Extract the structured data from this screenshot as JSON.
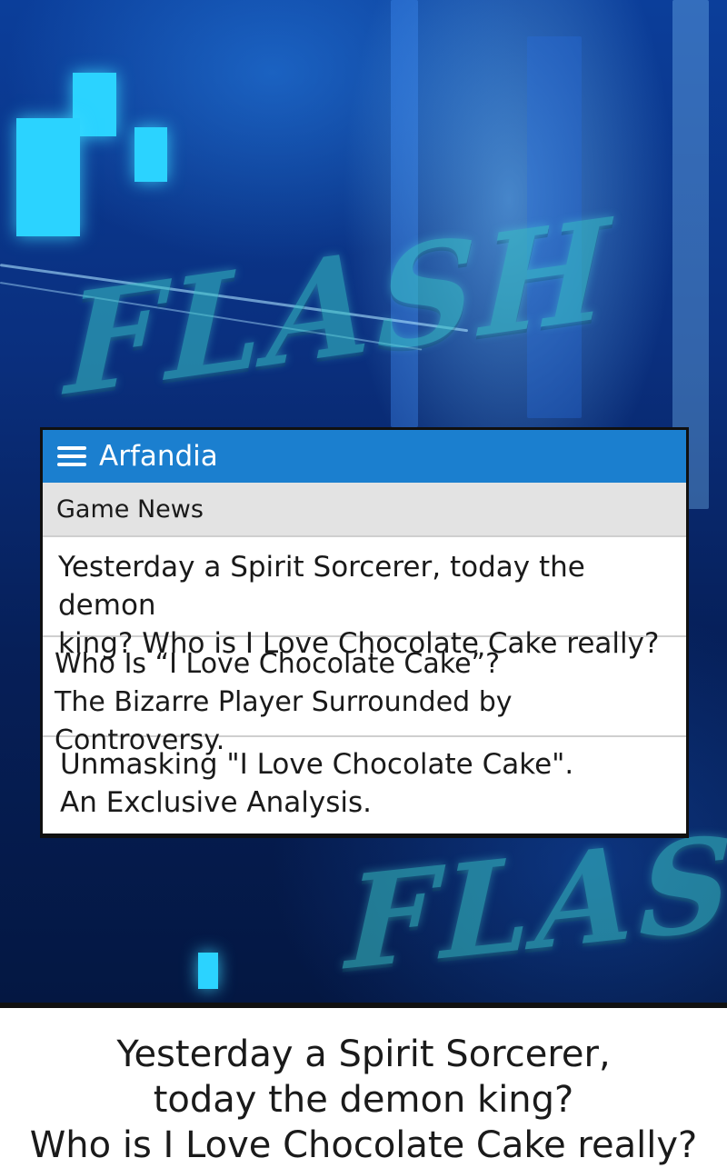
{
  "app": {
    "title": "Arfandia"
  },
  "category": {
    "label": "Game News"
  },
  "articles": [
    {
      "line1": "Yesterday a Spirit Sorcerer, today the demon",
      "line2": "king? Who is I Love Chocolate Cake really?"
    },
    {
      "line1": "Who Is “I Love Chocolate Cake”?",
      "line2": "The Bizarre Player Surrounded by Controversy."
    },
    {
      "line1": "Unmasking \"I Love Chocolate Cake\".",
      "line2": "An Exclusive Analysis."
    }
  ],
  "effects": {
    "flash_top": "FLASH",
    "flash_bottom": "FLASH"
  },
  "caption": {
    "line1": "Yesterday a Spirit Sorcerer,",
    "line2": "today the demon king?",
    "line3": "Who is I Love Chocolate Cake really?"
  },
  "colors": {
    "titlebar": "#1b7fcf",
    "background": "#0a2f7e",
    "flash_effect": "#39c6c8"
  },
  "icons": {
    "menu": "hamburger-menu-icon"
  }
}
